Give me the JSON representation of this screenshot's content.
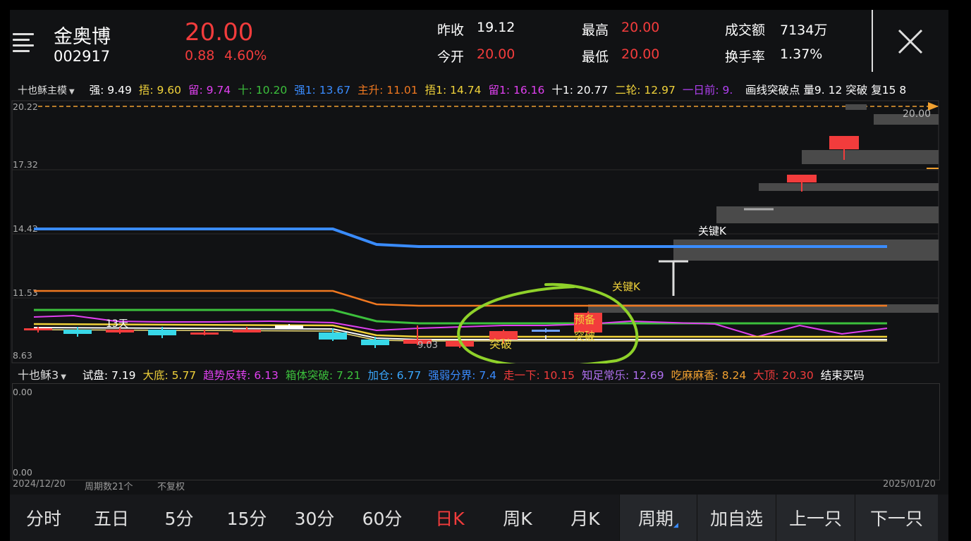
{
  "header": {
    "stock_name": "金奥博",
    "stock_code": "002917",
    "price": "20.00",
    "change": "0.88",
    "change_pct": "4.60%",
    "stats": [
      {
        "label": "昨收",
        "value": "19.12",
        "color": "#ffffff"
      },
      {
        "label": "今开",
        "value": "20.00",
        "color": "#f23c3c"
      },
      {
        "label": "最高",
        "value": "20.00",
        "color": "#f23c3c"
      },
      {
        "label": "最低",
        "value": "20.00",
        "color": "#f23c3c"
      },
      {
        "label": "成交额",
        "value": "7134万",
        "color": "#ffffff"
      },
      {
        "label": "换手率",
        "value": "1.37%",
        "color": "#ffffff"
      }
    ]
  },
  "main_indicator": {
    "name": "十也稣主模",
    "items": [
      {
        "text": "强: 9.49",
        "color": "#ffffff"
      },
      {
        "text": "捂: 9.60",
        "color": "#f0d23a"
      },
      {
        "text": "留: 9.74",
        "color": "#e040f0"
      },
      {
        "text": "十: 10.20",
        "color": "#3cc03c"
      },
      {
        "text": "强1: 13.67",
        "color": "#3a8cff"
      },
      {
        "text": "主升: 11.01",
        "color": "#f07820"
      },
      {
        "text": "捂1: 14.74",
        "color": "#f0d23a"
      },
      {
        "text": "留1: 16.16",
        "color": "#e040f0"
      },
      {
        "text": "十1: 20.77",
        "color": "#ffffff"
      },
      {
        "text": "二轮: 12.97",
        "color": "#f0d23a"
      },
      {
        "text": "一日前: 9.",
        "color": "#b040f0"
      }
    ],
    "overlay_text": "画线突破点 量9. 12 突破 复15 8",
    "overlay_color": "#ffffff"
  },
  "main_chart": {
    "price_labels": [
      "20.22",
      "17.32",
      "14.42",
      "11.53",
      "8.63"
    ],
    "last_price_label": "20.00",
    "annotations": [
      "13天",
      "9.03",
      "突破",
      "预备",
      "突破",
      "关键K",
      "关键K"
    ]
  },
  "sub_indicator": {
    "name": "十也稣3",
    "items": [
      {
        "text": "试盘: 7.19",
        "color": "#ffffff"
      },
      {
        "text": "大底: 5.77",
        "color": "#f0d23a"
      },
      {
        "text": "趋势反转: 6.13",
        "color": "#e040f0"
      },
      {
        "text": "箱体突破: 7.21",
        "color": "#3cc03c"
      },
      {
        "text": "加仓: 6.77",
        "color": "#3aa8ff"
      },
      {
        "text": "强弱分界: 7.4",
        "color": "#3a8cff"
      },
      {
        "text": "走一下: 10.15",
        "color": "#f23c3c"
      },
      {
        "text": "知足常乐: 12.69",
        "color": "#b070f0"
      },
      {
        "text": "吃麻麻香: 8.24",
        "color": "#f0a030"
      },
      {
        "text": "大顶: 20.30",
        "color": "#f23c3c"
      },
      {
        "text": "结束买码",
        "color": "#ffffff"
      }
    ],
    "axis_labels": [
      "0.00",
      "0.00"
    ]
  },
  "footer": {
    "start_date": "2024/12/20",
    "period_count": "周期数21个",
    "adjust": "不复权",
    "end_date": "2025/01/20"
  },
  "tabs": [
    {
      "label": "分时",
      "active": false,
      "button": false
    },
    {
      "label": "五日",
      "active": false,
      "button": false
    },
    {
      "label": "5分",
      "active": false,
      "button": false
    },
    {
      "label": "15分",
      "active": false,
      "button": false
    },
    {
      "label": "30分",
      "active": false,
      "button": false
    },
    {
      "label": "60分",
      "active": false,
      "button": false
    },
    {
      "label": "日K",
      "active": true,
      "button": false
    },
    {
      "label": "周K",
      "active": false,
      "button": false
    },
    {
      "label": "月K",
      "active": false,
      "button": false
    },
    {
      "label": "周期",
      "active": false,
      "button": true
    },
    {
      "label": "加自选",
      "active": false,
      "button": true
    },
    {
      "label": "上一只",
      "active": false,
      "button": true
    },
    {
      "label": "下一只",
      "active": false,
      "button": true
    }
  ],
  "colors": {
    "up": "#f23c3c",
    "down": "#38d8e8",
    "blue_line": "#3a8cff",
    "orange_line": "#f07820",
    "green_line": "#3cc03c",
    "magenta_line": "#e040f0",
    "highlight_circle": "#8fd12a"
  }
}
